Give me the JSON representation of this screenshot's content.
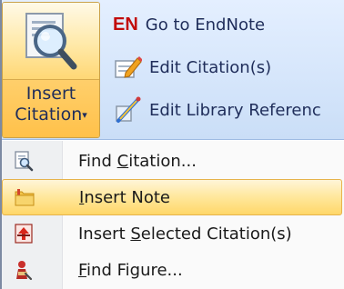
{
  "ribbon": {
    "insert_citation": {
      "line1": "Insert",
      "line2": "Citation",
      "caret": "▾",
      "icon": "magnifier-icon"
    },
    "commands": [
      {
        "badge": "EN",
        "label": "Go to EndNote",
        "icon": "endnote-logo"
      },
      {
        "label": "Edit Citation(s)",
        "icon": "edit-pencil-icon"
      },
      {
        "label": "Edit Library Referenc",
        "icon": "edit-library-icon"
      }
    ]
  },
  "menu": {
    "items": [
      {
        "pre": "Find ",
        "ul": "C",
        "post": "itation...",
        "icon": "find-doc-icon",
        "active": false
      },
      {
        "pre": "",
        "ul": "I",
        "post": "nsert Note",
        "icon": "folder-note-icon",
        "active": true
      },
      {
        "pre": "Insert ",
        "ul": "S",
        "post": "elected Citation(s)",
        "icon": "insert-selected-icon",
        "active": false
      },
      {
        "pre": "",
        "ul": "F",
        "post": "ind Figure...",
        "icon": "find-figure-icon",
        "active": false
      }
    ]
  },
  "colors": {
    "highlight_top": "#fff5d8",
    "highlight_bottom": "#ffd769",
    "highlight_border": "#e6b34b",
    "ribbon_bg": "#d6e6fb",
    "label_text": "#1f2d5a",
    "en_red": "#c20c0c"
  }
}
